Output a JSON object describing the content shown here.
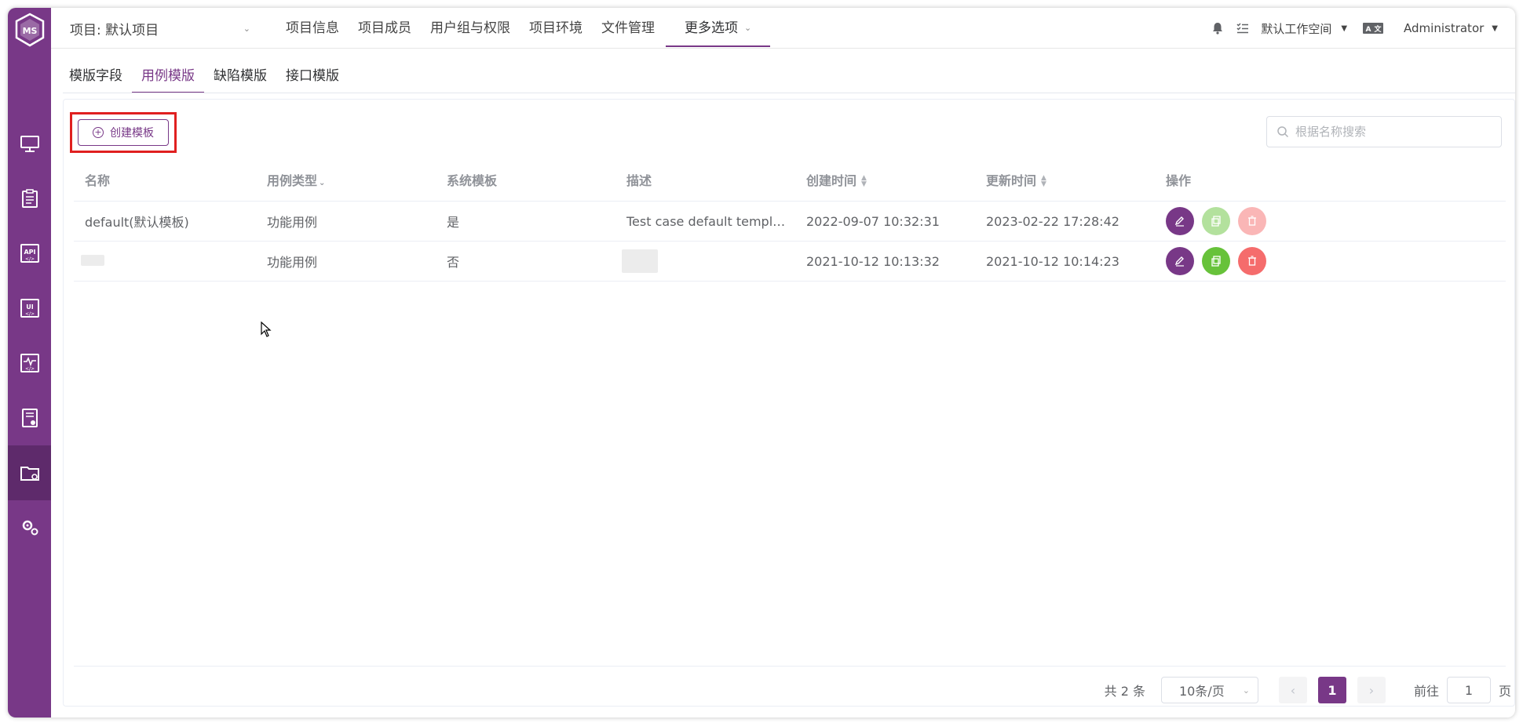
{
  "topbar": {
    "project_select": "项目: 默认项目",
    "nav": [
      "项目信息",
      "项目成员",
      "用户组与权限",
      "项目环境",
      "文件管理"
    ],
    "more_options": "更多选项",
    "workspace": "默认工作空间",
    "user": "Administrator"
  },
  "subtabs": [
    "模版字段",
    "用例模版",
    "缺陷模版",
    "接口模版"
  ],
  "toolbar": {
    "create_label": "创建模板",
    "search_placeholder": "根据名称搜索"
  },
  "table": {
    "headers": {
      "name": "名称",
      "case_type": "用例类型",
      "system": "系统模板",
      "desc": "描述",
      "created": "创建时间",
      "updated": "更新时间",
      "ops": "操作"
    },
    "rows": [
      {
        "name": "default(默认模板)",
        "case_type": "功能用例",
        "system": "是",
        "desc": "Test case default template",
        "created": "2022-09-07 10:32:31",
        "updated": "2023-02-22 17:28:42"
      },
      {
        "name": "",
        "case_type": "功能用例",
        "system": "否",
        "desc": "",
        "created": "2021-10-12 10:13:32",
        "updated": "2021-10-12 10:14:23"
      }
    ]
  },
  "pagination": {
    "total": "共 2 条",
    "page_size": "10条/页",
    "current_page": "1",
    "goto_prefix": "前往",
    "goto_value": "1",
    "goto_suffix": "页"
  },
  "colors": {
    "primary": "#783887",
    "success": "#67c23a",
    "danger": "#f56c6c"
  }
}
